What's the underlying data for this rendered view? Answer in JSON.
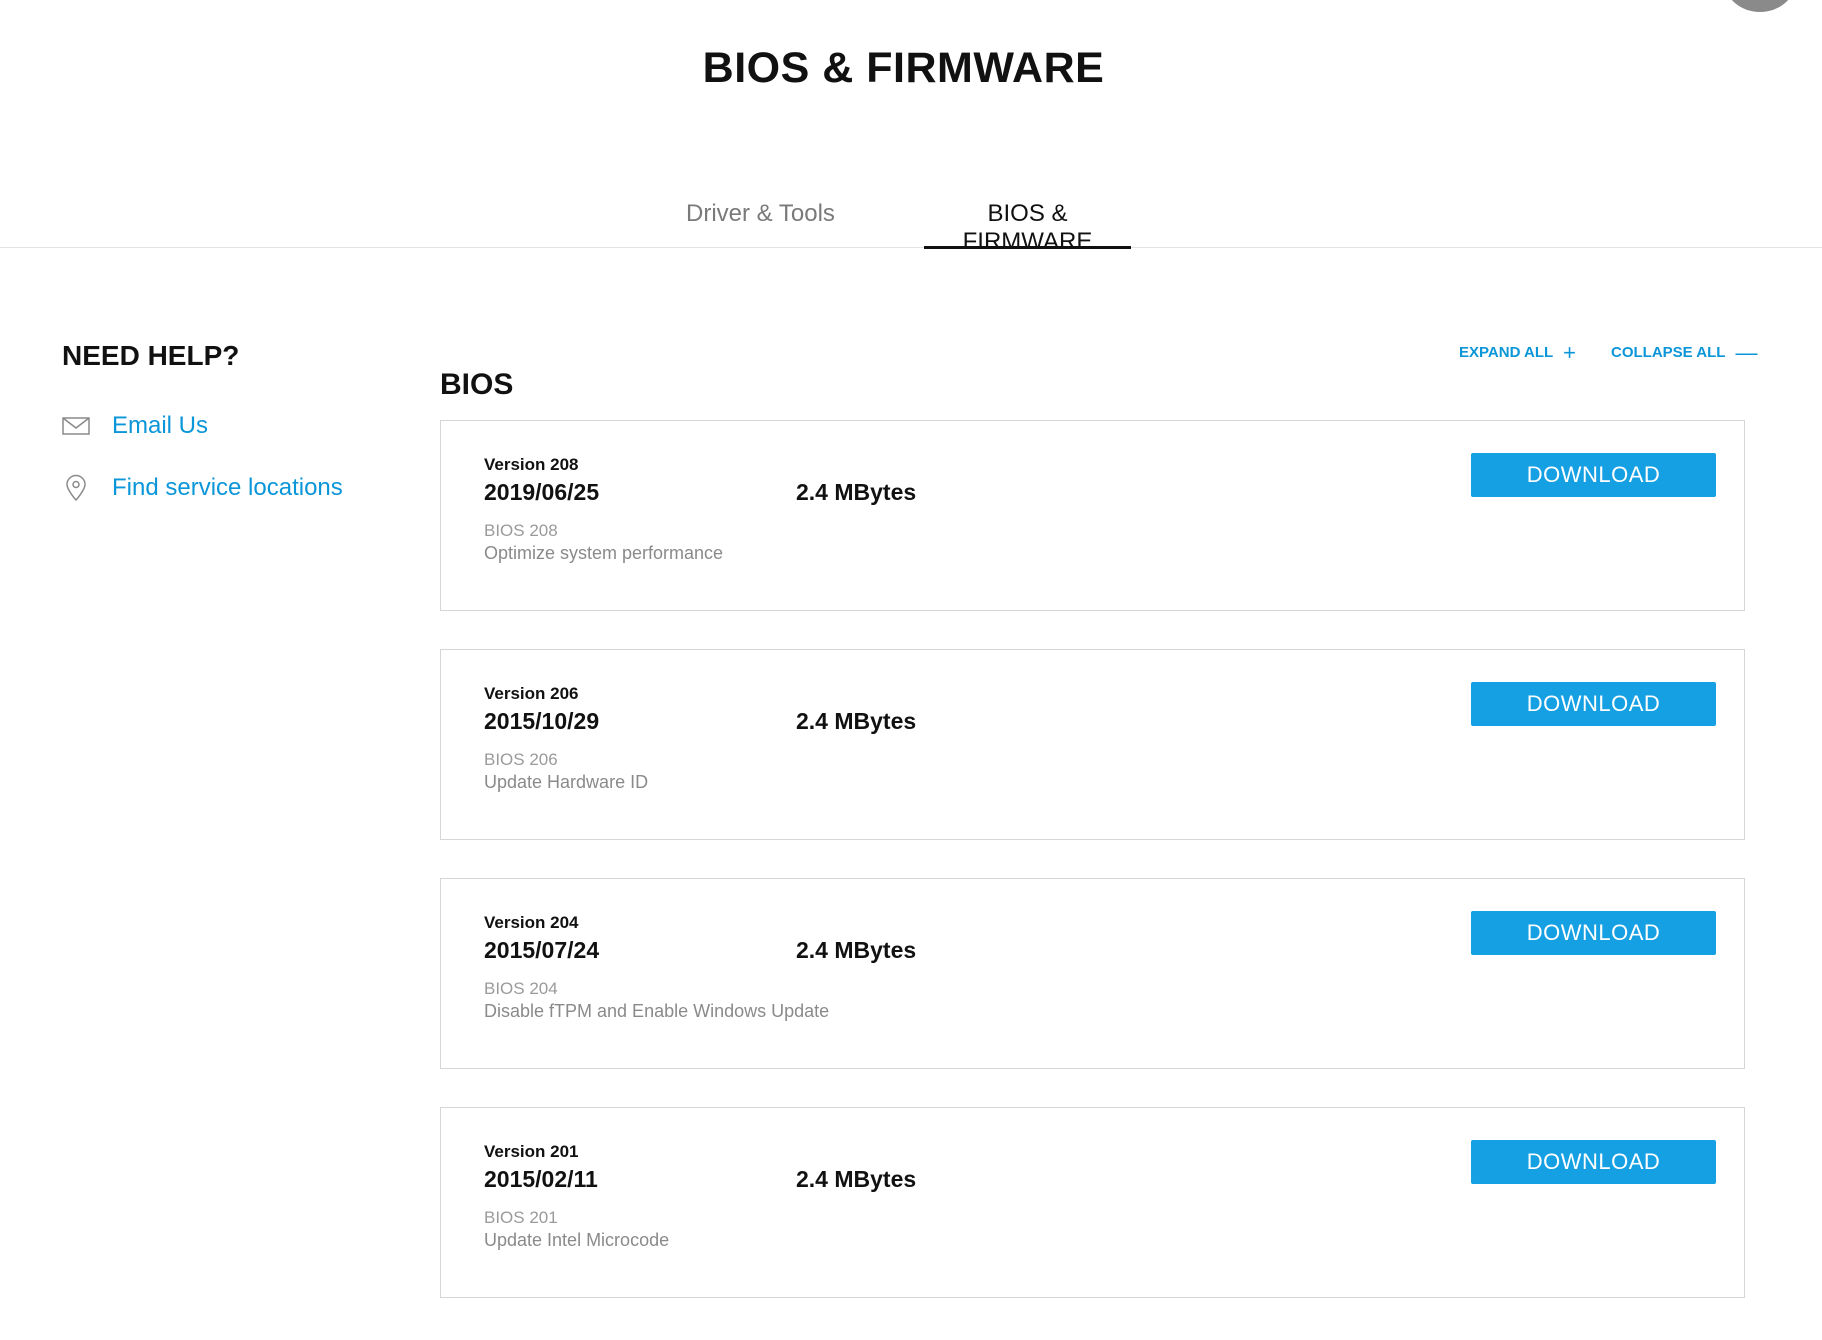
{
  "page": {
    "title": "BIOS & FIRMWARE"
  },
  "tabs": [
    {
      "label": "Driver & Tools",
      "active": false
    },
    {
      "label": "BIOS & FIRMWARE",
      "active": true
    }
  ],
  "help": {
    "title": "NEED HELP?",
    "email_label": "Email Us",
    "email_icon": "mail-icon",
    "location_label": "Find service locations",
    "location_icon": "map-pin-icon"
  },
  "section": {
    "title": "BIOS",
    "expand_all_label": "EXPAND ALL",
    "expand_all_symbol": "+",
    "collapse_all_label": "COLLAPSE ALL",
    "collapse_all_symbol": "—"
  },
  "items": [
    {
      "version": "Version 208",
      "date": "2019/06/25",
      "size": "2.4 MBytes",
      "name": "BIOS 208",
      "description": "Optimize system performance",
      "download_label": "DOWNLOAD"
    },
    {
      "version": "Version 206",
      "date": "2015/10/29",
      "size": "2.4 MBytes",
      "name": "BIOS 206",
      "description": "Update Hardware ID",
      "download_label": "DOWNLOAD"
    },
    {
      "version": "Version 204",
      "date": "2015/07/24",
      "size": "2.4 MBytes",
      "name": "BIOS 204",
      "description": "Disable fTPM and Enable Windows Update",
      "download_label": "DOWNLOAD"
    },
    {
      "version": "Version 201",
      "date": "2015/02/11",
      "size": "2.4 MBytes",
      "name": "BIOS 201",
      "description": "Update Intel Microcode",
      "download_label": "DOWNLOAD"
    }
  ],
  "colors": {
    "accent": "#0a96d8",
    "button": "#14a0e3",
    "text": "#111111",
    "muted": "#8a8a8a",
    "border": "#d6d6d6"
  }
}
